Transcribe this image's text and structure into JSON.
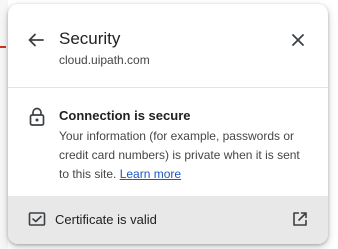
{
  "popup": {
    "title": "Security",
    "domain": "cloud.uipath.com",
    "back_icon": "arrow-left-icon",
    "close_icon": "close-icon"
  },
  "connection": {
    "icon": "lock-icon",
    "heading": "Connection is secure",
    "description": "Your information (for example, passwords or credit card numbers) is private when it is sent to this site.",
    "learn_more": "Learn more"
  },
  "certificate": {
    "icon": "certificate-icon",
    "label": "Certificate is valid",
    "external_icon": "open-in-new-icon"
  },
  "colors": {
    "link": "#1a57c9",
    "footer_bg": "#e8e8e8",
    "text_primary": "#202124",
    "text_secondary": "#444746"
  }
}
